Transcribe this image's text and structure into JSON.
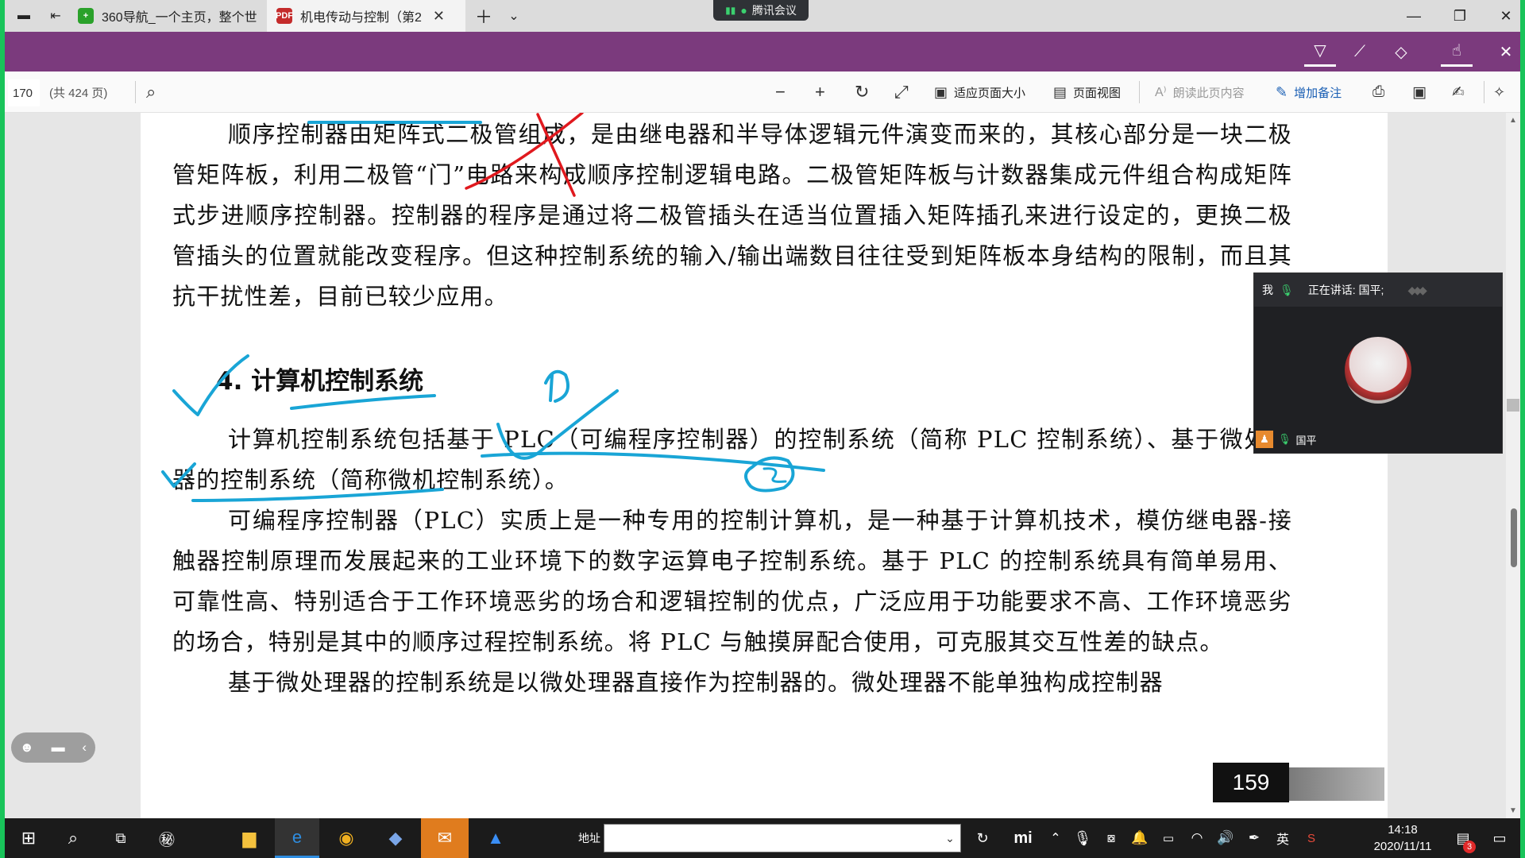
{
  "browser": {
    "tabs": [
      {
        "label": "360导航_一个主页，整个世",
        "active": false
      },
      {
        "label": "机电传动与控制（第2",
        "active": true
      }
    ],
    "meeting_pill": "腾讯会议"
  },
  "pdf_toolbar": {
    "page_number": "170",
    "total_pages": "(共 424 页)",
    "fit_page": "适应页面大小",
    "page_view": "页面视图",
    "read_aloud": "朗读此页内容",
    "add_notes": "增加备注"
  },
  "document": {
    "para1": "顺序控制器由矩阵式二极管组成，是由继电器和半导体逻辑元件演变而来的，其核心部分是一块二极管矩阵板，利用二极管“门”电路来构成顺序控制逻辑电路。二极管矩阵板与计数器集成元件组合构成矩阵式步进顺序控制器。控制器的程序是通过将二极管插头在适当位置插入矩阵插孔来进行设定的，更换二极管插头的位置就能改变程序。但这种控制系统的输入/输出端数目往往受到矩阵板本身结构的限制，而且其抗干扰性差，目前已较少应用。",
    "heading": "4.  计算机控制系统",
    "para2": "计算机控制系统包括基于 PLC（可编程序控制器）的控制系统（简称 PLC 控制系统）、基于微处理器的控制系统（简称微机控制系统）。",
    "para3": "可编程序控制器（PLC）实质上是一种专用的控制计算机，是一种基于计算机技术，模仿继电器-接触器控制原理而发展起来的工业环境下的数字运算电子控制系统。基于 PLC 的控制系统具有简单易用、可靠性高、特别适合于工作环境恶劣的场合和逻辑控制的优点，广泛应用于功能要求不高、工作环境恶劣的场合，特别是其中的顺序过程控制系统。将 PLC 与触摸屏配合使用，可克服其交互性差的缺点。",
    "para4": "基于微处理器的控制系统是以微处理器直接作为控制器的。微处理器不能单独构成控制器",
    "page_footer": "159"
  },
  "meeting_panel": {
    "me": "我",
    "speaking": "正在讲话: 国平;",
    "participant": "国平"
  },
  "taskbar": {
    "address_label": "地址",
    "ime": "英",
    "time": "14:18",
    "date": "2020/11/11",
    "notif_count": "3"
  },
  "colors": {
    "purple_toolbar": "#7b3a7d",
    "annotation_blue": "#19a5d6",
    "annotation_red": "#e0191e",
    "accent_green": "#19c45a"
  }
}
